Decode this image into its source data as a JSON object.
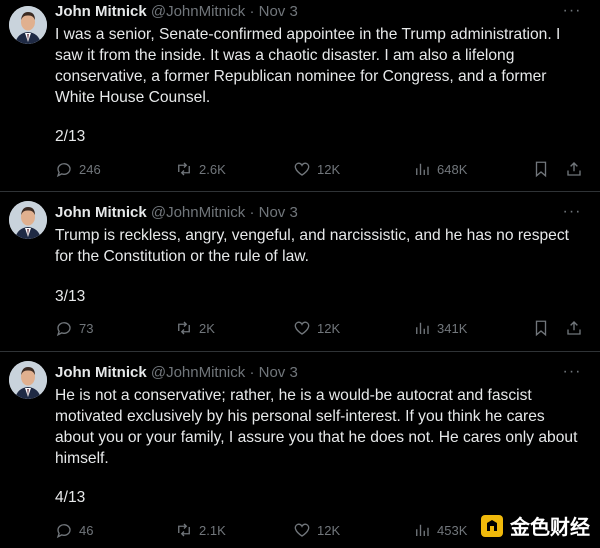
{
  "author": {
    "name": "John Mitnick",
    "handle": "@JohnMitnick",
    "separator": "·",
    "date": "Nov 3"
  },
  "tweets": [
    {
      "text": "I was a senior, Senate-confirmed appointee in the Trump administration. I saw it from the inside. It was a chaotic disaster. I am also a lifelong conservative, a former Republican nominee for Congress, and a former White House Counsel.",
      "counter": "2/13",
      "replies": "246",
      "retweets": "2.6K",
      "likes": "12K",
      "views": "648K"
    },
    {
      "text": "Trump is reckless, angry, vengeful, and narcissistic, and he has no respect for the Constitution or the rule of law.",
      "counter": "3/13",
      "replies": "73",
      "retweets": "2K",
      "likes": "12K",
      "views": "341K"
    },
    {
      "text": "He is not a conservative; rather, he is a would-be autocrat and fascist motivated exclusively by his personal self-interest. If you think he cares about you or your family, I assure you that he does not. He cares only about himself.",
      "counter": "4/13",
      "replies": "46",
      "retweets": "2.1K",
      "likes": "12K",
      "views": "453K"
    }
  ],
  "icons": {
    "reply": "reply-icon",
    "retweet": "retweet-icon",
    "like": "heart-icon",
    "views": "views-icon",
    "bookmark": "bookmark-icon",
    "share": "share-icon",
    "more": "more-icon"
  },
  "watermark": {
    "text": "金色财经",
    "color": "#f0b90b"
  },
  "colors": {
    "background": "#000000",
    "text": "#e7e9ea",
    "muted": "#71767b",
    "divider": "#2f3336"
  }
}
